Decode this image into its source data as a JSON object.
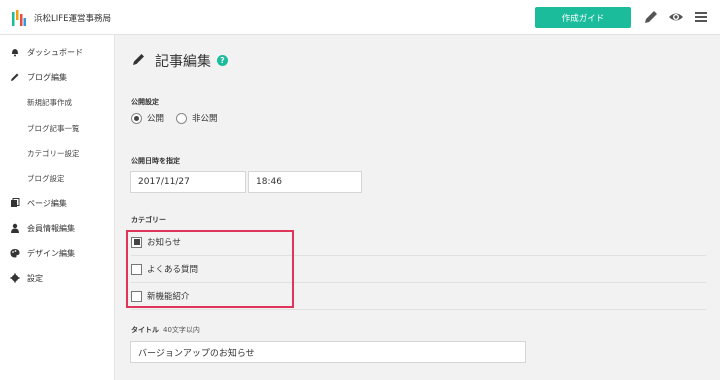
{
  "header": {
    "site_title": "浜松LIFE運営事務局",
    "guide_button": "作成ガイド",
    "brand_color": "#1abc9c"
  },
  "sidebar": {
    "items": [
      {
        "label": "ダッシュボード",
        "icon": "bell-icon"
      },
      {
        "label": "ブログ編集",
        "icon": "pencil-icon"
      },
      {
        "label": "新規記事作成",
        "sub": true
      },
      {
        "label": "ブログ記事一覧",
        "sub": true
      },
      {
        "label": "カテゴリー設定",
        "sub": true
      },
      {
        "label": "ブログ設定",
        "sub": true
      },
      {
        "label": "ページ編集",
        "icon": "pages-icon"
      },
      {
        "label": "会員情報編集",
        "icon": "user-icon"
      },
      {
        "label": "デザイン編集",
        "icon": "palette-icon"
      },
      {
        "label": "設定",
        "icon": "gear-icon"
      }
    ]
  },
  "main": {
    "title": "記事編集",
    "publish": {
      "label": "公開設定",
      "options": [
        "公開",
        "非公開"
      ],
      "selected": "公開"
    },
    "datetime": {
      "label": "公開日時を指定",
      "date": "2017/11/27",
      "time": "18:46"
    },
    "category": {
      "label": "カテゴリー",
      "items": [
        {
          "label": "お知らせ",
          "checked": true
        },
        {
          "label": "よくある質問",
          "checked": false
        },
        {
          "label": "新機能紹介",
          "checked": false
        }
      ],
      "highlight_color": "#e0345a"
    },
    "title_field": {
      "label": "タイトル",
      "hint": "40文字以内",
      "value": "バージョンアップのお知らせ"
    }
  }
}
